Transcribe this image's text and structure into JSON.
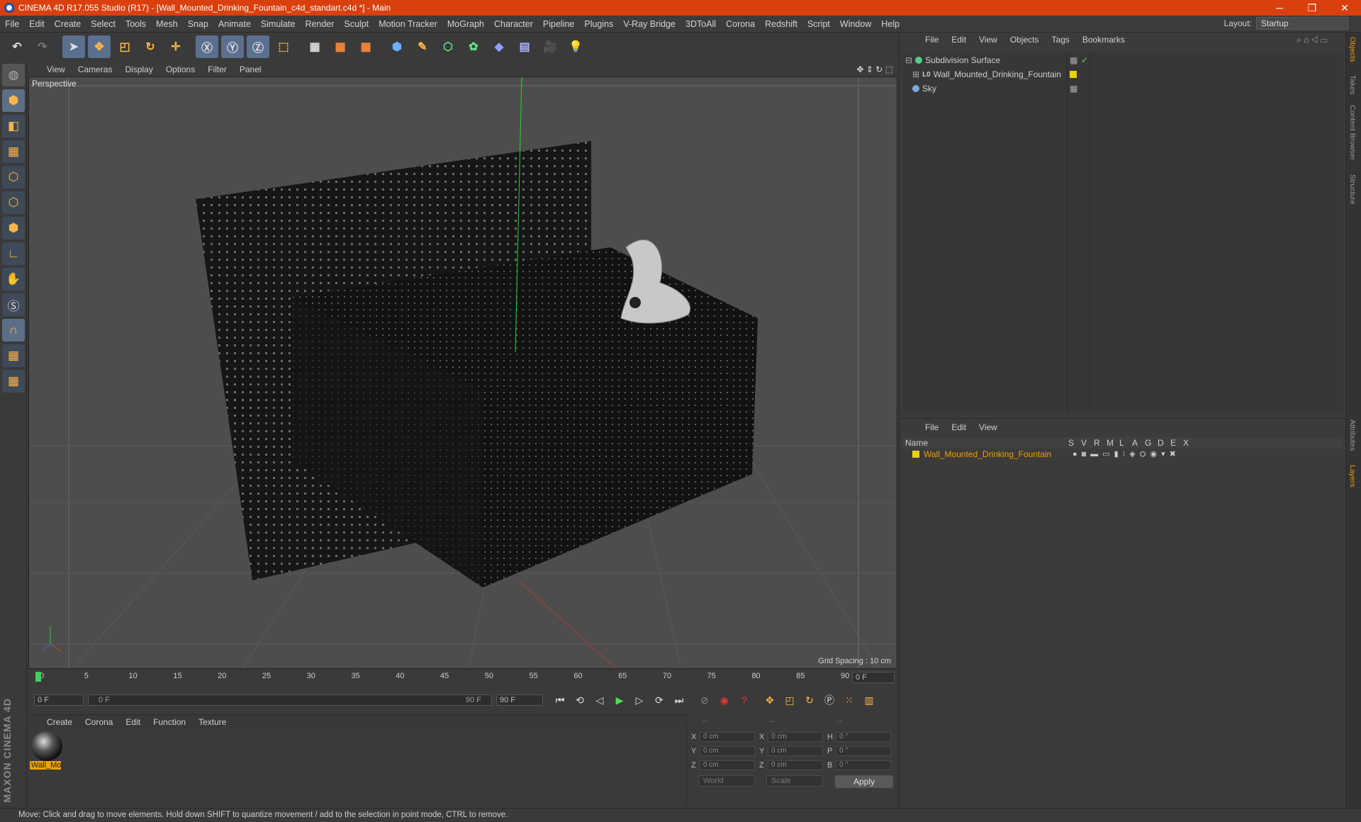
{
  "window": {
    "title": "CINEMA 4D R17.055 Studio (R17) - [Wall_Mounted_Drinking_Fountain_c4d_standart.c4d *] - Main",
    "min": "─",
    "max": "❐",
    "close": "✕"
  },
  "menubar": {
    "items": [
      "File",
      "Edit",
      "Create",
      "Select",
      "Tools",
      "Mesh",
      "Snap",
      "Animate",
      "Simulate",
      "Render",
      "Sculpt",
      "Motion Tracker",
      "MoGraph",
      "Character",
      "Pipeline",
      "Plugins",
      "V-Ray Bridge",
      "3DToAll",
      "Corona",
      "Redshift",
      "Script",
      "Window",
      "Help"
    ],
    "layout_label": "Layout:",
    "layout_value": "Startup"
  },
  "viewport": {
    "menu": [
      "View",
      "Cameras",
      "Display",
      "Options",
      "Filter",
      "Panel"
    ],
    "label": "Perspective",
    "grid_spacing": "Grid Spacing : 10 cm"
  },
  "timeline": {
    "ticks": [
      "0",
      "5",
      "10",
      "15",
      "20",
      "25",
      "30",
      "35",
      "40",
      "45",
      "50",
      "55",
      "60",
      "65",
      "70",
      "75",
      "80",
      "85",
      "90"
    ],
    "current_frame": "0 F"
  },
  "playbar": {
    "start": "0 F",
    "range_start": "0 F",
    "range_end": "90 F",
    "end": "90 F"
  },
  "material_panel": {
    "menu": [
      "Create",
      "Corona",
      "Edit",
      "Function",
      "Texture"
    ],
    "material_name": "Wall_Mo"
  },
  "coords": {
    "header": [
      "--",
      "--",
      "--"
    ],
    "rows": [
      [
        "X",
        "0 cm",
        "X",
        "0 cm",
        "H",
        "0 °"
      ],
      [
        "Y",
        "0 cm",
        "Y",
        "0 cm",
        "P",
        "0 °"
      ],
      [
        "Z",
        "0 cm",
        "Z",
        "0 cm",
        "B",
        "0 °"
      ]
    ],
    "mode": "World",
    "transform": "Scale",
    "apply": "Apply"
  },
  "object_panel": {
    "menu": [
      "File",
      "Edit",
      "View",
      "Objects",
      "Tags",
      "Bookmarks"
    ],
    "objects": [
      "Subdivision Surface",
      "Wall_Mounted_Drinking_Fountain",
      "Sky"
    ]
  },
  "layer_panel": {
    "menu": [
      "File",
      "Edit",
      "View"
    ],
    "name_header": "Name",
    "columns": [
      "S",
      "V",
      "R",
      "M",
      "L",
      "A",
      "G",
      "D",
      "E",
      "X"
    ],
    "layer_name": "Wall_Mounted_Drinking_Fountain"
  },
  "right_tabs": [
    "Objects",
    "Takes",
    "Content Browser",
    "Structure",
    "Attributes",
    "Layers"
  ],
  "status": "Move: Click and drag to move elements. Hold down SHIFT to quantize movement / add to the selection in point mode, CTRL to remove.",
  "maxon": "MAXON CINEMA 4D"
}
